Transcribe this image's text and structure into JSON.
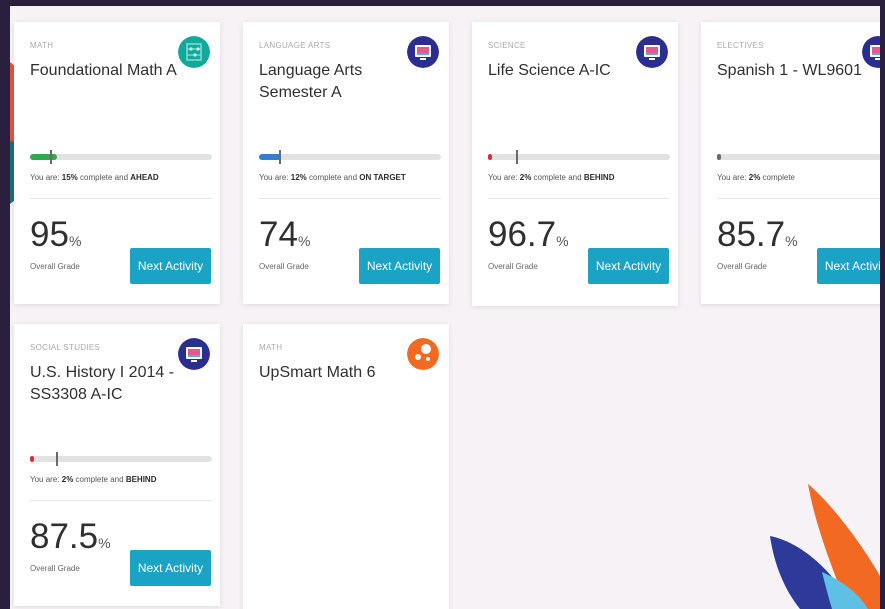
{
  "colors": {
    "accent": "#1aa3c4",
    "ahead": "#33a84a",
    "on_target": "#2f7fd6",
    "behind": "#d6303c"
  },
  "labels": {
    "you_are": "You are:",
    "complete_and": "complete and",
    "complete": "complete",
    "overall_grade": "Overall Grade",
    "next_activity": "Next Activity"
  },
  "courses": [
    {
      "subject": "MATH",
      "title": "Foundational Math A",
      "icon": "abacus-icon",
      "progress_pct": "15%",
      "progress": 0.15,
      "status": "AHEAD",
      "grade": "95",
      "grade_unit": "%"
    },
    {
      "subject": "LANGUAGE ARTS",
      "title": "Language Arts Semester A",
      "icon": "monitor-icon",
      "progress_pct": "12%",
      "progress": 0.12,
      "status": "ON TARGET",
      "grade": "74",
      "grade_unit": "%"
    },
    {
      "subject": "SCIENCE",
      "title": "Life Science A-IC",
      "icon": "monitor-icon",
      "progress_pct": "2%",
      "progress": 0.02,
      "status": "BEHIND",
      "grade": "96.7",
      "grade_unit": "%"
    },
    {
      "subject": "ELECTIVES",
      "title": "Spanish 1 - WL9601",
      "icon": "monitor-icon",
      "progress_pct": "2%",
      "progress": 0.02,
      "status": "",
      "grade": "85.7",
      "grade_unit": "%"
    },
    {
      "subject": "SOCIAL STUDIES",
      "title": "U.S. History I 2014 - SS3308 A-IC",
      "icon": "monitor-icon",
      "progress_pct": "2%",
      "progress": 0.02,
      "status": "BEHIND",
      "grade": "87.5",
      "grade_unit": "%"
    },
    {
      "subject": "MATH",
      "title": "UpSmart Math 6",
      "icon": "bubbles-icon"
    }
  ]
}
